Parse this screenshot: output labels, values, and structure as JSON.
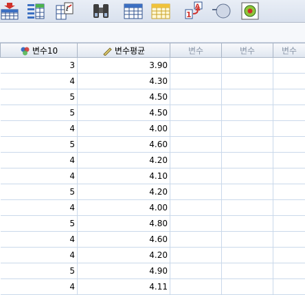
{
  "toolbar": {
    "icons": [
      "insert-cases-icon",
      "variables-icon",
      "goto-case-icon",
      "find-binoculars-icon",
      "split-file-icon",
      "select-cases-icon",
      "value-labels-icon",
      "use-sets-icon",
      "spelling-icon"
    ]
  },
  "table": {
    "columns": [
      {
        "label": "변수10",
        "icon": "nominal-measure-icon"
      },
      {
        "label": "변수평균",
        "icon": "scale-ruler-icon"
      },
      {
        "label": "변수"
      },
      {
        "label": "변수"
      },
      {
        "label": "변수"
      }
    ],
    "rows": [
      [
        "3",
        "3.90"
      ],
      [
        "4",
        "4.30"
      ],
      [
        "5",
        "4.50"
      ],
      [
        "5",
        "4.50"
      ],
      [
        "4",
        "4.00"
      ],
      [
        "5",
        "4.60"
      ],
      [
        "4",
        "4.20"
      ],
      [
        "4",
        "4.10"
      ],
      [
        "5",
        "4.20"
      ],
      [
        "4",
        "4.00"
      ],
      [
        "5",
        "4.80"
      ],
      [
        "4",
        "4.60"
      ],
      [
        "4",
        "4.20"
      ],
      [
        "5",
        "4.90"
      ],
      [
        "4",
        "4.11"
      ]
    ]
  }
}
